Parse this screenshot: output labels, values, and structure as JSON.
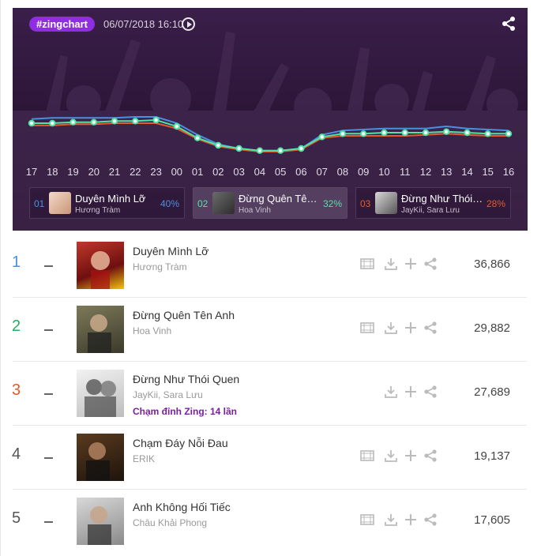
{
  "header": {
    "tag": "#zingchart",
    "timestamp": "06/07/2018 16:10"
  },
  "chart_data": {
    "type": "line",
    "x": [
      "17",
      "18",
      "19",
      "20",
      "21",
      "22",
      "23",
      "00",
      "01",
      "02",
      "03",
      "04",
      "05",
      "06",
      "07",
      "08",
      "09",
      "10",
      "11",
      "12",
      "13",
      "14",
      "15",
      "16"
    ],
    "series": [
      {
        "name": "Duyên Mình Lỡ",
        "color": "#4a90e2",
        "values": [
          62,
          63,
          63,
          63,
          63,
          64,
          64,
          58,
          47,
          38,
          34,
          32,
          32,
          34,
          47,
          51,
          52,
          53,
          53,
          53,
          55,
          53,
          52,
          51
        ]
      },
      {
        "name": "Đừng Quên Tên Anh",
        "color": "#50e3a4",
        "values": [
          58,
          58,
          59,
          59,
          60,
          60,
          61,
          55,
          44,
          37,
          34,
          32,
          32,
          34,
          45,
          48,
          48,
          49,
          49,
          49,
          50,
          49,
          48,
          48
        ]
      },
      {
        "name": "Đừng Như Thói Quen",
        "color": "#e35b2b",
        "values": [
          56,
          56,
          57,
          57,
          58,
          58,
          58,
          53,
          43,
          36,
          33,
          31,
          31,
          33,
          44,
          46,
          46,
          46,
          46,
          47,
          48,
          47,
          46,
          46
        ]
      }
    ]
  },
  "top3": [
    {
      "rank": "01",
      "title": "Duyên Mình Lỡ",
      "artist": "Hương Tràm",
      "percent": "40%",
      "color": "#4a90e2"
    },
    {
      "rank": "02",
      "title": "Đừng Quên Tên Anh",
      "artist": "Hoa Vinh",
      "percent": "32%",
      "color": "#50e3a4"
    },
    {
      "rank": "03",
      "title": "Đừng Như Thói Quen",
      "artist": "JayKii, Sara Lưu",
      "percent": "28%",
      "color": "#e35b2b"
    }
  ],
  "songs": [
    {
      "rank": "1",
      "rank_color": "#4a90e2",
      "title": "Duyên Mình Lỡ",
      "artist": "Hương Tràm",
      "note": "",
      "plays": "36,866",
      "has_mv": true
    },
    {
      "rank": "2",
      "rank_color": "#27ae60",
      "title": "Đừng Quên Tên Anh",
      "artist": "Hoa Vinh",
      "note": "",
      "plays": "29,882",
      "has_mv": true
    },
    {
      "rank": "3",
      "rank_color": "#e35b2b",
      "title": "Đừng Như Thói Quen",
      "artist": "JayKii, Sara Lưu",
      "note": "Chạm đỉnh Zing: 14 lần",
      "plays": "27,689",
      "has_mv": false
    },
    {
      "rank": "4",
      "rank_color": "#555555",
      "title": "Chạm Đáy Nỗi Đau",
      "artist": "ERIK",
      "note": "",
      "plays": "19,137",
      "has_mv": true
    },
    {
      "rank": "5",
      "rank_color": "#555555",
      "title": "Anh Không Hối Tiếc",
      "artist": "Châu Khải Phong",
      "note": "",
      "plays": "17,605",
      "has_mv": true
    }
  ]
}
